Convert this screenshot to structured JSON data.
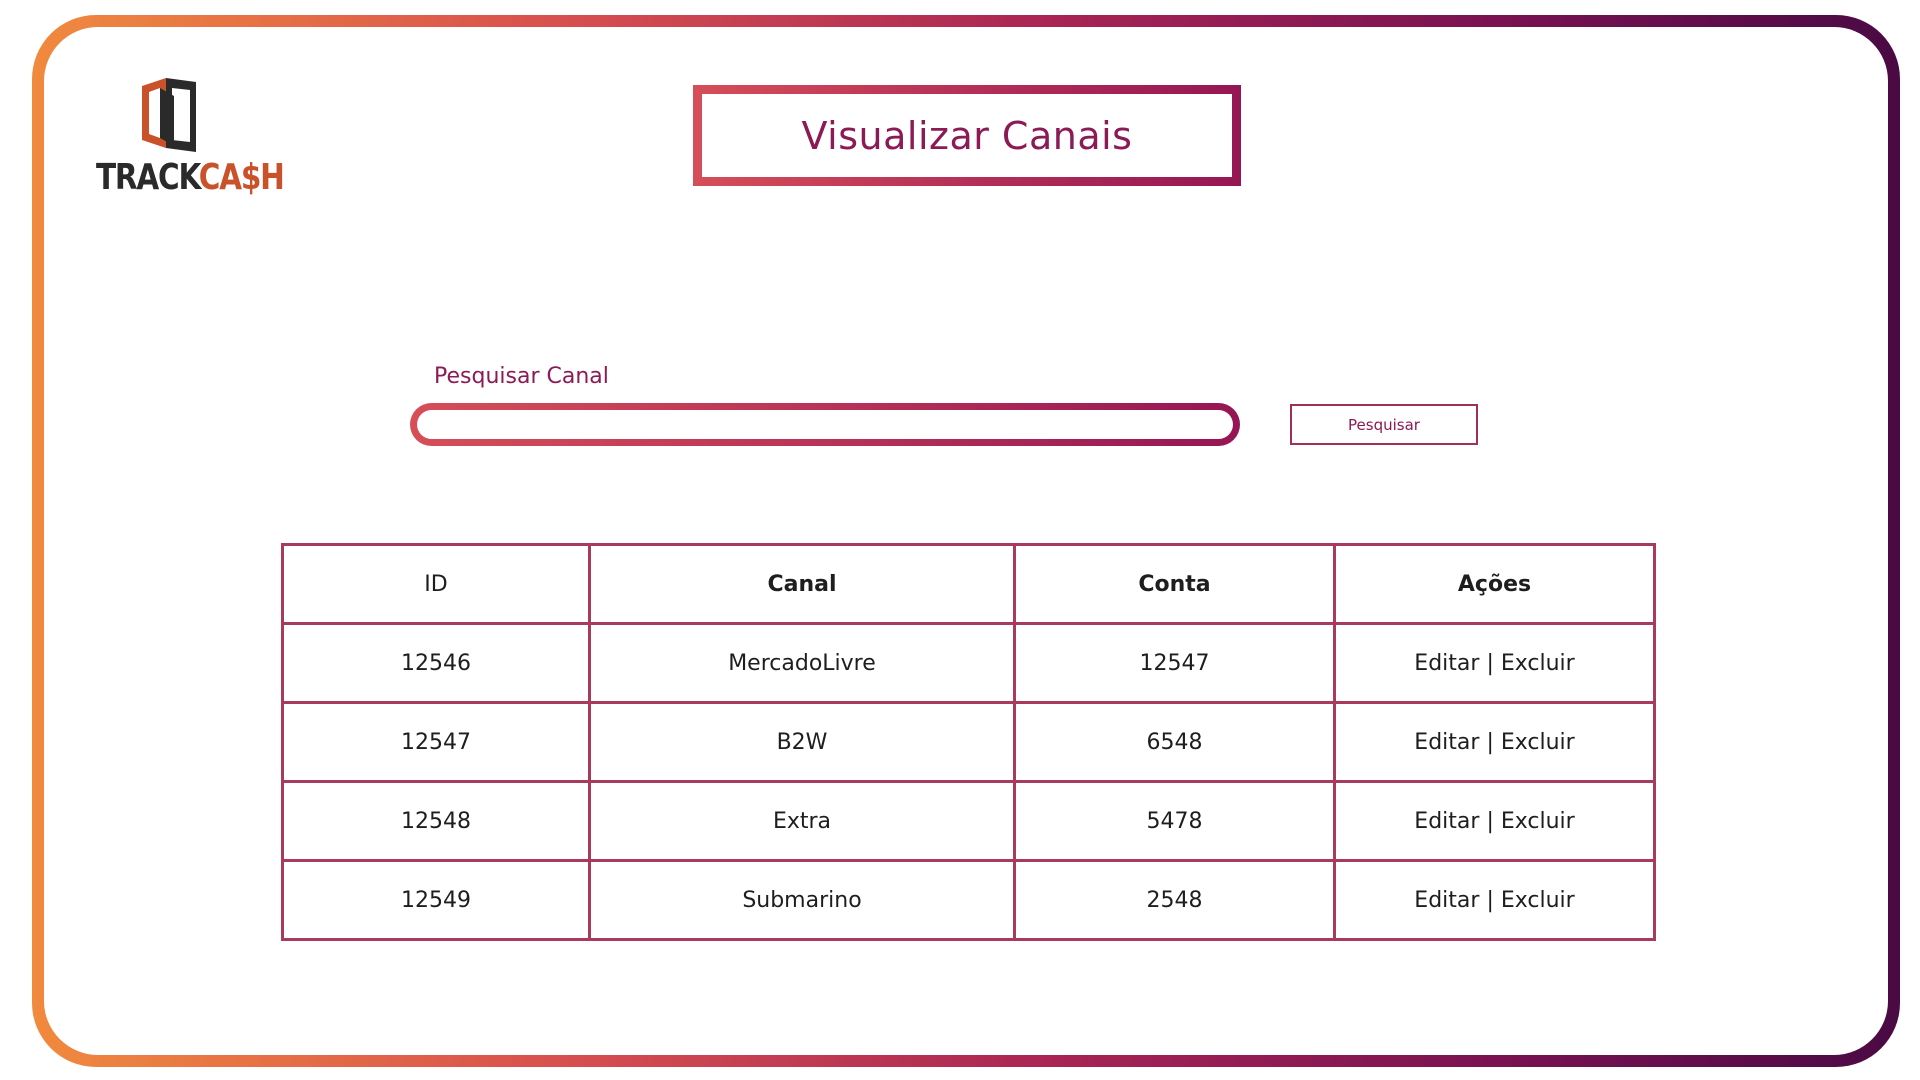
{
  "app": {
    "logo_text_left": "TRACK",
    "logo_text_right": "CA$H",
    "page_title": "Visualizar Canais"
  },
  "search": {
    "label": "Pesquisar Canal",
    "value": "",
    "placeholder": "",
    "button_label": "Pesquisar"
  },
  "table": {
    "headers": [
      "ID",
      "Canal",
      "Conta",
      "Ações"
    ],
    "rows": [
      {
        "id": "12546",
        "canal": "MercadoLivre",
        "conta": "12547",
        "edit": "Editar",
        "sep": "|",
        "delete": "Excluir"
      },
      {
        "id": "12547",
        "canal": "B2W",
        "conta": "6548",
        "edit": "Editar",
        "sep": "|",
        "delete": "Excluir"
      },
      {
        "id": "12548",
        "canal": "Extra",
        "conta": "5478",
        "edit": "Editar",
        "sep": "|",
        "delete": "Excluir"
      },
      {
        "id": "12549",
        "canal": "Submarino",
        "conta": "2548",
        "edit": "Editar",
        "sep": "|",
        "delete": "Excluir"
      }
    ]
  },
  "colors": {
    "accent": "#8b1a55",
    "border": "#a83a5c",
    "frame_start": "#f08a3e",
    "frame_end": "#4a0a44"
  },
  "icons": [
    "trackcash-logo-icon"
  ]
}
